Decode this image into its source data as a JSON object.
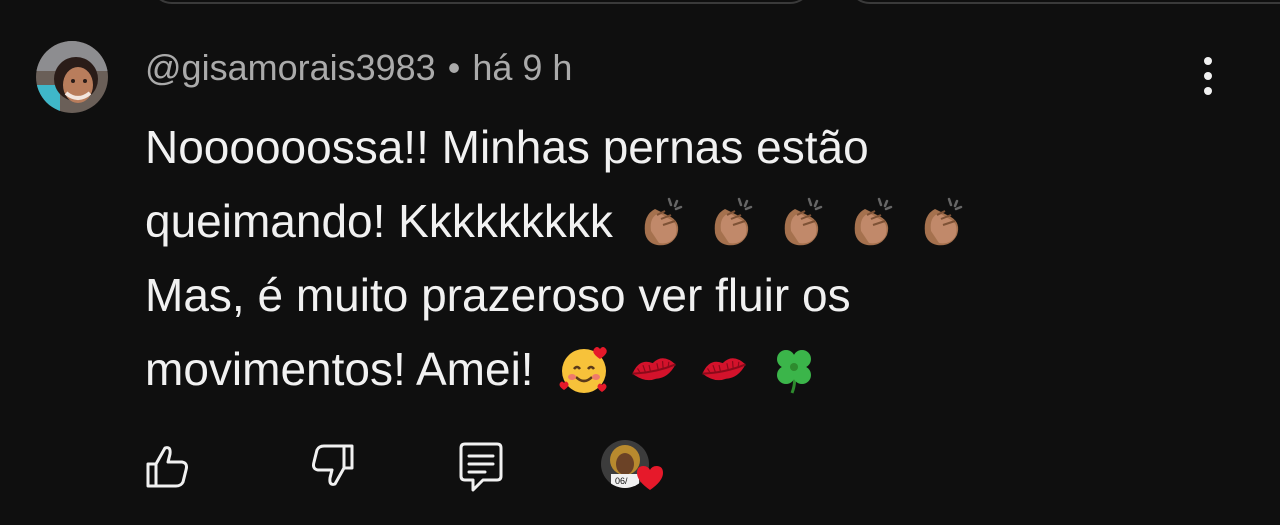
{
  "comment": {
    "author": "@gisamorais3983",
    "separator": "•",
    "time": "há 9 h",
    "lines": [
      "Noooooossa!! Minhas pernas estão",
      "queimando! Kkkkkkkkk",
      "Mas, é muito prazeroso ver fluir os",
      "movimentos! Amei!"
    ],
    "line2_emojis": [
      "clapping-hands-medium-skin-tone",
      "clapping-hands-medium-skin-tone",
      "clapping-hands-medium-skin-tone",
      "clapping-hands-medium-skin-tone",
      "clapping-hands-medium-skin-tone"
    ],
    "line4_emojis": [
      "smiling-face-with-hearts",
      "kiss-mark",
      "kiss-mark",
      "four-leaf-clover"
    ]
  },
  "actions": {
    "like_icon": "thumbs-up-icon",
    "dislike_icon": "thumbs-down-icon",
    "reply_icon": "comment-icon",
    "creator_heart_badge": "06/"
  },
  "colors": {
    "background": "#0f0f0f",
    "text": "#f1f1f1",
    "secondary_text": "#aaaaaa",
    "heart": "#e6192a"
  }
}
